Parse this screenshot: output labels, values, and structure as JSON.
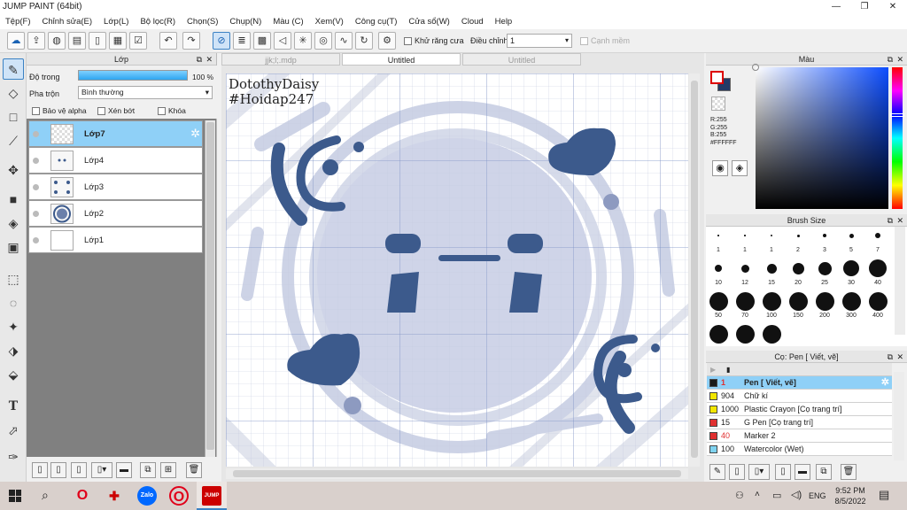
{
  "window": {
    "title": "JUMP PAINT (64bit)",
    "min": "—",
    "max": "❐",
    "close": "✕"
  },
  "menu": [
    "Tệp(F)",
    "Chỉnh sửa(E)",
    "Lớp(L)",
    "Bộ lọc(R)",
    "Chọn(S)",
    "Chụp(N)",
    "Màu (C)",
    "Xem(V)",
    "Công cụ(T)",
    "Cửa sổ(W)",
    "Cloud",
    "Help"
  ],
  "toolbar": {
    "antialias_label": "Khử răng cưa",
    "adjust_label": "Điều chỉnh",
    "adjust_value": "1",
    "smooth_label": "Cạnh mềm"
  },
  "layer_panel": {
    "title": "Lớp",
    "opacity_label": "Độ trong",
    "opacity_value": "100 %",
    "opacity_fraction": 1.0,
    "blend_label": "Pha trộn",
    "blend_value": "Bình thường",
    "protect_alpha": "Bảo vệ alpha",
    "clip": "Xén bớt",
    "lock": "Khóa",
    "layers": [
      {
        "name": "Lớp7",
        "selected": true
      },
      {
        "name": "Lớp4",
        "selected": false
      },
      {
        "name": "Lớp3",
        "selected": false
      },
      {
        "name": "Lớp2",
        "selected": false
      },
      {
        "name": "Lớp1",
        "selected": false
      }
    ]
  },
  "documents": {
    "tabs": [
      "jjk;l;.mdp",
      "Untitled",
      "Untitled"
    ],
    "active_tab": 1,
    "watermark_line1": "DotothyDaisy",
    "watermark_line2": "#Hoidap247"
  },
  "color_panel": {
    "title": "Màu",
    "r": "R:255",
    "g": "G:255",
    "b": "B:255",
    "hex": "#FFFFFF"
  },
  "brush_size": {
    "title": "Brush Size",
    "sizes": [
      "1",
      "1",
      "1",
      "2",
      "3",
      "5",
      "7",
      "10",
      "12",
      "15",
      "20",
      "25",
      "30",
      "40",
      "50",
      "70",
      "100",
      "150",
      "200",
      "300",
      "400"
    ]
  },
  "pen_panel": {
    "title": "Cọ: Pen [ Viết, vẽ]",
    "pens": [
      {
        "size": "1",
        "name": "Pen [ Viết, vẽ]",
        "color": "#1a1a1a",
        "selected": true
      },
      {
        "size": "904",
        "name": "Chữ kí",
        "color": "#f2e600",
        "selected": false
      },
      {
        "size": "1000",
        "name": "Plastic Crayon [Cọ trang trí]",
        "color": "#f2e600",
        "selected": false
      },
      {
        "size": "15",
        "name": "G Pen [Cọ trang trí]",
        "color": "#e03030",
        "selected": false
      },
      {
        "size": "40",
        "name": "Marker 2",
        "color": "#e03030",
        "selected": false
      },
      {
        "size": "100",
        "name": "Watercolor (Wet)",
        "color": "#7fd3f0",
        "selected": false
      }
    ]
  },
  "taskbar": {
    "time": "9:52 PM",
    "date": "8/5/2022",
    "lang": "ENG",
    "apps": [
      "O",
      "✚",
      "Zalo",
      "O",
      "JUMP"
    ]
  },
  "colors": {
    "accent": "#3b82c4",
    "selection": "#8fd0f7",
    "art": "#3c5a8c"
  }
}
